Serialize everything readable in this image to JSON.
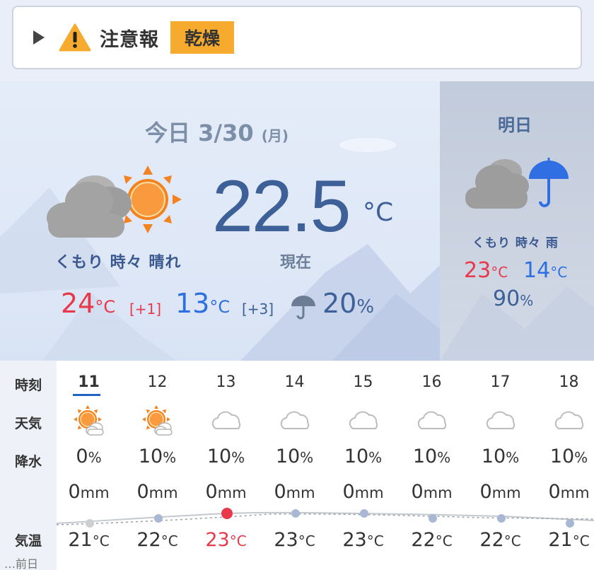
{
  "alert": {
    "label": "注意報",
    "tag": "乾燥"
  },
  "today": {
    "date": "今日 3/30",
    "dow": "(月)",
    "current_temp": "22.5",
    "current_unit": "°C",
    "now_label": "現在",
    "condition": "くもり 時々 晴れ",
    "high": "24",
    "high_unit": "°C",
    "high_diff": "[+1]",
    "low": "13",
    "low_unit": "°C",
    "low_diff": "[+3]",
    "rain": "20",
    "rain_unit": "%"
  },
  "tomorrow": {
    "title": "明日",
    "condition": "くもり 時々 雨",
    "high": "23",
    "high_unit": "°C",
    "low": "14",
    "low_unit": "°C",
    "rain": "90",
    "rain_unit": "%"
  },
  "hourly": {
    "labels": {
      "time": "時刻",
      "weather": "天気",
      "rain": "降水",
      "temp": "気温",
      "prev": "…前日"
    },
    "pct_unit": "%",
    "mm_unit": "mm",
    "temp_unit": "°C",
    "hours": [
      {
        "hour": "11",
        "weather": "sunny-cloudy-icon",
        "pct": "0",
        "mm": "0",
        "temp": "21"
      },
      {
        "hour": "12",
        "weather": "sunny-cloudy-icon",
        "pct": "10",
        "mm": "0",
        "temp": "22"
      },
      {
        "hour": "13",
        "weather": "cloud-icon",
        "pct": "10",
        "mm": "0",
        "temp": "23"
      },
      {
        "hour": "14",
        "weather": "cloud-icon",
        "pct": "10",
        "mm": "0",
        "temp": "23"
      },
      {
        "hour": "15",
        "weather": "cloud-icon",
        "pct": "10",
        "mm": "0",
        "temp": "23"
      },
      {
        "hour": "16",
        "weather": "cloud-icon",
        "pct": "10",
        "mm": "0",
        "temp": "22"
      },
      {
        "hour": "17",
        "weather": "cloud-icon",
        "pct": "10",
        "mm": "0",
        "temp": "22"
      },
      {
        "hour": "18",
        "weather": "cloud-icon",
        "pct": "10",
        "mm": "0",
        "temp": "21"
      }
    ]
  },
  "colors": {
    "high": "#e8384a",
    "low": "#2b6fe0",
    "accent": "#3d6098",
    "alert": "#f6ab2f"
  }
}
